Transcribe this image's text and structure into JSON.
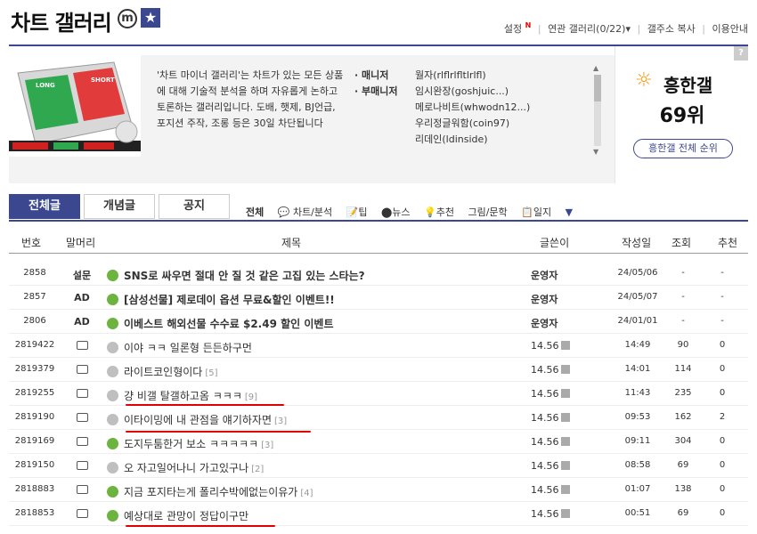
{
  "header": {
    "title": "차트 갤러리",
    "m_badge": "m",
    "links": [
      "설정",
      "연관 갤러리(0/22)▾",
      "갤주소 복사",
      "이용안내"
    ],
    "settings_badge": "N"
  },
  "intro": {
    "description": "'차트 마이너 갤러리'는 차트가 있는 모든 상품에 대해 기술적 분석을 하며 자유롭게 논하고 토론하는 갤러리입니다. 도배, 햇제, BJ언급, 포지션 주작, 조롱 등은 30일 차단됩니다",
    "managers": [
      {
        "label": "· 매니저",
        "value": "월자(rlflrlfltlrlfl)"
      },
      {
        "label": "· 부매니저",
        "value": "임시완장(goshjuic...)"
      },
      {
        "label": "",
        "value": "메로나비트(whwodn12...)"
      },
      {
        "label": "",
        "value": "우리정글워함(coin97)"
      },
      {
        "label": "",
        "value": "리데인(ldinside)"
      }
    ],
    "thumb_labels": {
      "long": "LONG",
      "short": "SHORT"
    }
  },
  "ranking": {
    "question": "?",
    "name": "흥한갤",
    "position": "69위",
    "button": "흥한갤 전체 순위"
  },
  "tabs": [
    "전체글",
    "개념글",
    "공지"
  ],
  "categories": [
    "전체",
    "💬 차트/분석",
    "📝팁",
    "⬤뉴스",
    "💡추천",
    "그림/문학",
    "📋일지",
    "▼"
  ],
  "table": {
    "headers": [
      "번호",
      "말머리",
      "제목",
      "글쓴이",
      "작성일",
      "조회",
      "추천"
    ],
    "rows": [
      {
        "num": "2858",
        "head": "설문",
        "subject": "SNS로 싸우면 절대 안 질 것 같은 고집 있는 스타는?",
        "comments": "",
        "writer": "운영자",
        "date": "24/05/06",
        "views": "-",
        "rec": "-",
        "icon": "green",
        "notice": true
      },
      {
        "num": "2857",
        "head": "AD",
        "subject": "[삼성선물] 제로데이 옵션 무료&할인 이벤트!!",
        "comments": "",
        "writer": "운영자",
        "date": "24/05/07",
        "views": "-",
        "rec": "-",
        "icon": "green",
        "notice": true
      },
      {
        "num": "2806",
        "head": "AD",
        "subject": "이베스트 해외선물 수수료 $2.49 할인 이벤트",
        "comments": "",
        "writer": "운영자",
        "date": "24/01/01",
        "views": "-",
        "rec": "-",
        "icon": "green",
        "notice": true
      },
      {
        "num": "2819422",
        "head": "",
        "subject": "이야 ㅋㅋ 일론형 든든하구먼",
        "comments": "",
        "writer": "14.56",
        "date": "14:49",
        "views": "90",
        "rec": "0",
        "icon": "gray",
        "notice": false
      },
      {
        "num": "2819379",
        "head": "",
        "subject": "라이트코인형이다",
        "comments": "[5]",
        "writer": "14.56",
        "date": "14:01",
        "views": "114",
        "rec": "0",
        "icon": "gray",
        "notice": false
      },
      {
        "num": "2819255",
        "head": "",
        "subject": "걍 비갤 탈갤하고옴 ㅋㅋㅋ",
        "comments": "[9]",
        "writer": "14.56",
        "date": "11:43",
        "views": "235",
        "rec": "0",
        "icon": "gray",
        "notice": false
      },
      {
        "num": "2819190",
        "head": "",
        "subject": "이타이밍에 내 관점을 얘기하자면",
        "comments": "[3]",
        "writer": "14.56",
        "date": "09:53",
        "views": "162",
        "rec": "2",
        "icon": "gray",
        "notice": false
      },
      {
        "num": "2819169",
        "head": "",
        "subject": "도지두툼한거 보소 ㅋㅋㅋㅋㅋ",
        "comments": "[3]",
        "writer": "14.56",
        "date": "09:11",
        "views": "304",
        "rec": "0",
        "icon": "green",
        "notice": false
      },
      {
        "num": "2819150",
        "head": "",
        "subject": "오 자고일어나니 가고있구나",
        "comments": "[2]",
        "writer": "14.56",
        "date": "08:58",
        "views": "69",
        "rec": "0",
        "icon": "gray",
        "notice": false
      },
      {
        "num": "2818883",
        "head": "",
        "subject": "지금 포지타는게 폴리수박에없는이유가",
        "comments": "[4]",
        "writer": "14.56",
        "date": "01:07",
        "views": "138",
        "rec": "0",
        "icon": "green",
        "notice": false
      },
      {
        "num": "2818853",
        "head": "",
        "subject": "예상대로 관망이 정답이구만",
        "comments": "",
        "writer": "14.56",
        "date": "00:51",
        "views": "69",
        "rec": "0",
        "icon": "green",
        "notice": false
      }
    ]
  }
}
